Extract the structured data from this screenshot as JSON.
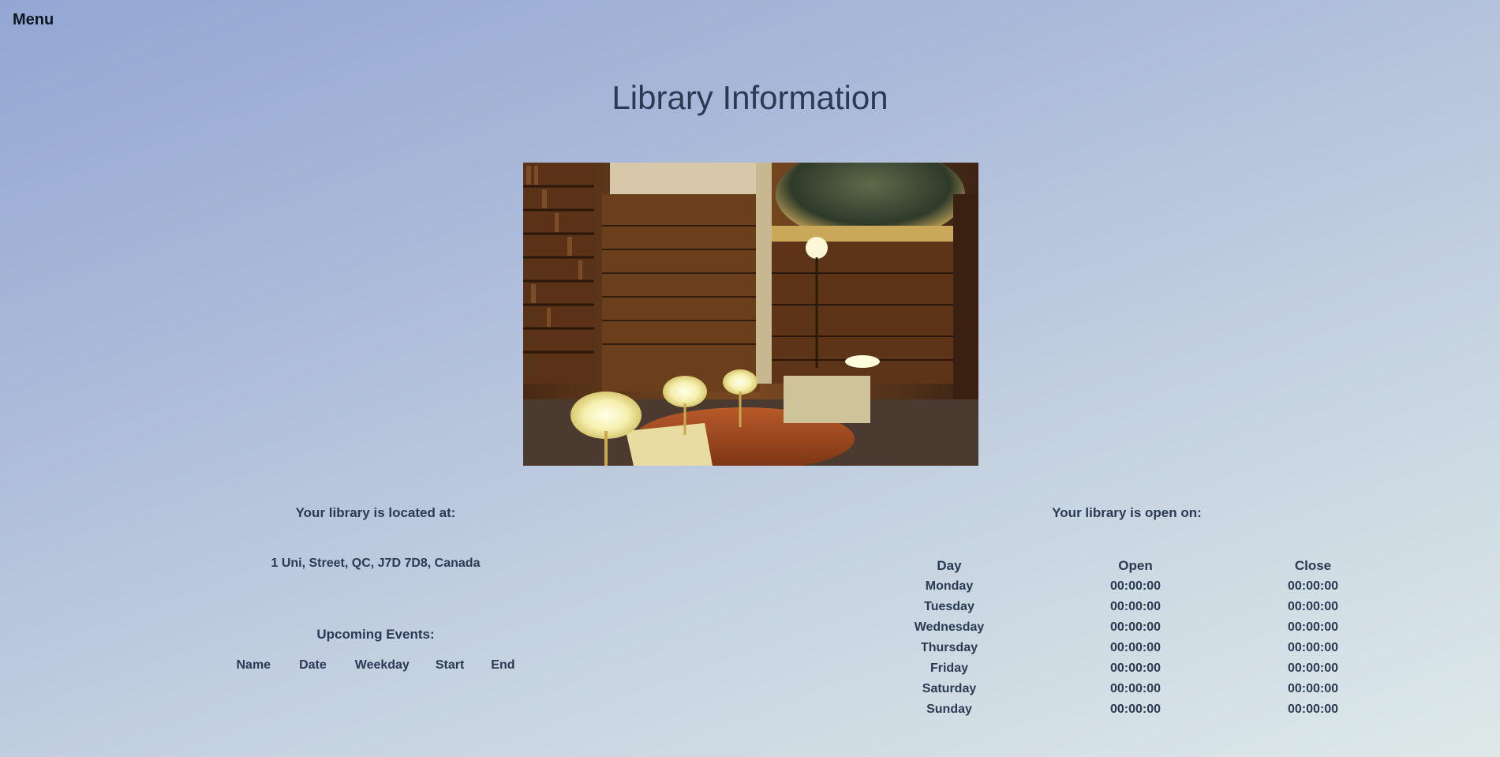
{
  "nav": {
    "menu_label": "Menu"
  },
  "page": {
    "title": "Library Information"
  },
  "image": {
    "icon": "library-photo",
    "alt": "Library interior"
  },
  "location": {
    "heading": "Your library is located at:",
    "address": "1 Uni, Street, QC, J7D 7D8, Canada"
  },
  "events": {
    "heading": "Upcoming Events:",
    "columns": [
      "Name",
      "Date",
      "Weekday",
      "Start",
      "End"
    ],
    "rows": []
  },
  "hours": {
    "heading": "Your library is open on:",
    "columns": [
      "Day",
      "Open",
      "Close"
    ],
    "rows": [
      {
        "day": "Monday",
        "open": "00:00:00",
        "close": "00:00:00"
      },
      {
        "day": "Tuesday",
        "open": "00:00:00",
        "close": "00:00:00"
      },
      {
        "day": "Wednesday",
        "open": "00:00:00",
        "close": "00:00:00"
      },
      {
        "day": "Thursday",
        "open": "00:00:00",
        "close": "00:00:00"
      },
      {
        "day": "Friday",
        "open": "00:00:00",
        "close": "00:00:00"
      },
      {
        "day": "Saturday",
        "open": "00:00:00",
        "close": "00:00:00"
      },
      {
        "day": "Sunday",
        "open": "00:00:00",
        "close": "00:00:00"
      }
    ]
  }
}
